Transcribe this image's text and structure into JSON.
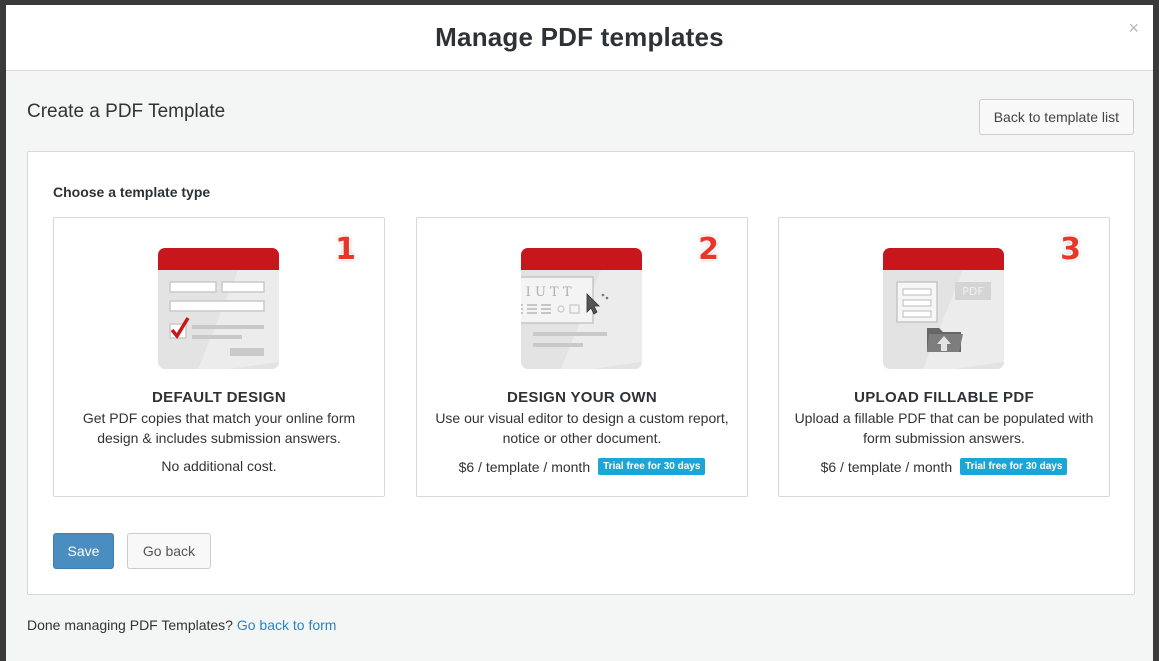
{
  "modal": {
    "title": "Manage PDF templates",
    "close_glyph": "×"
  },
  "page": {
    "heading": "Create a PDF Template",
    "back_to_list_label": "Back to template list"
  },
  "panel": {
    "label": "Choose a template type",
    "cards": [
      {
        "number": "1",
        "title": "DEFAULT DESIGN",
        "desc": "Get PDF copies that match your online form design & includes submission answers.",
        "price": "No additional cost.",
        "badge": "",
        "icon": "default-design-icon"
      },
      {
        "number": "2",
        "title": "DESIGN YOUR OWN",
        "desc": "Use our visual editor to design a custom report, notice or other document.",
        "price": "$6 / template / month",
        "badge": "Trial free for 30 days",
        "icon": "design-editor-icon",
        "editor_letters": "B I U T T"
      },
      {
        "number": "3",
        "title": "UPLOAD FILLABLE PDF",
        "desc": "Upload a fillable PDF that can be populated with form submission answers.",
        "price": "$6 / template / month",
        "badge": "Trial free for 30 days",
        "icon": "upload-pdf-icon",
        "pdf_label": "PDF"
      }
    ],
    "save_label": "Save",
    "go_back_label": "Go back"
  },
  "footer": {
    "text": "Done managing PDF Templates?",
    "link_label": "Go back to form"
  },
  "colors": {
    "header_red": "#c8161d",
    "primary_blue": "#4a8dc0",
    "badge_blue": "#1ba6d8",
    "link_blue": "#2a85c5",
    "number_red": "#e8362b"
  }
}
